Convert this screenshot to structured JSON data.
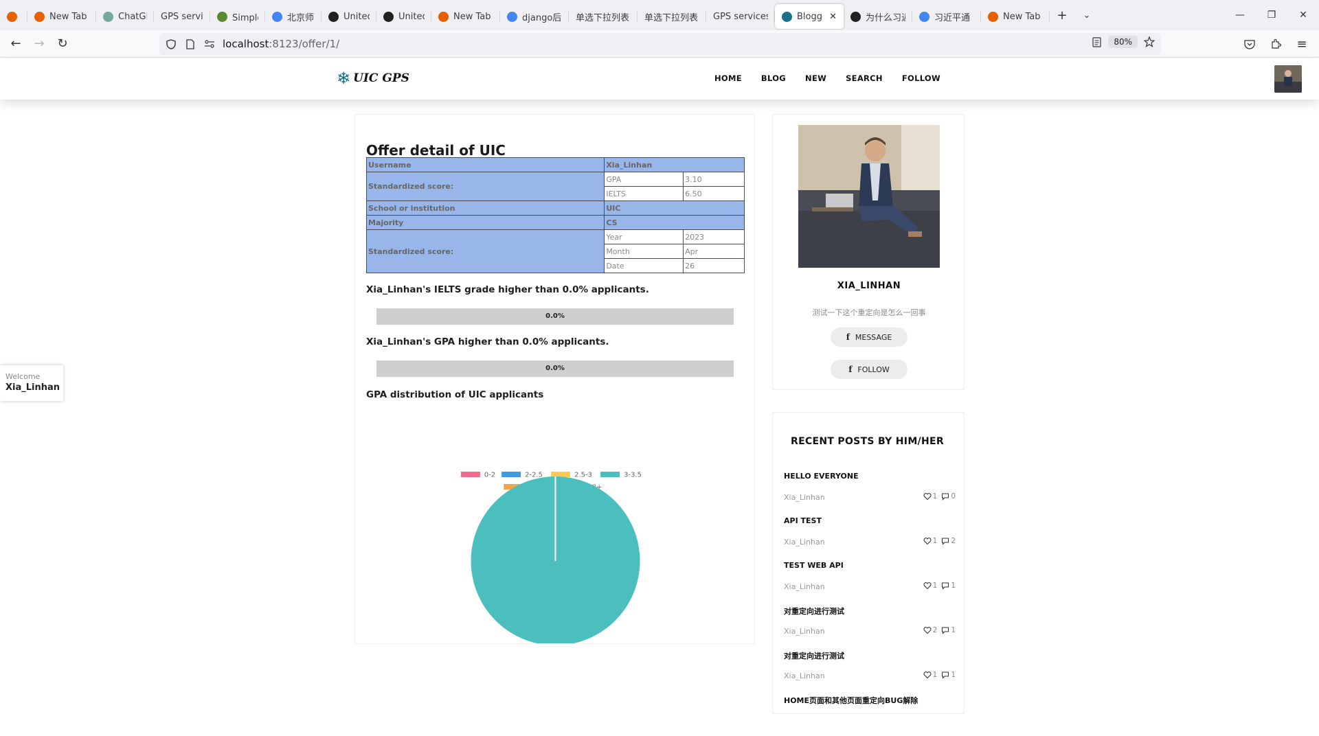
{
  "browser": {
    "tabs": [
      {
        "title": "",
        "favicon_color": "#e66000",
        "pinned": true
      },
      {
        "title": "New Tab",
        "favicon_color": "#e66000"
      },
      {
        "title": "ChatGPT",
        "favicon_color": "#74aa9c"
      },
      {
        "title": "GPS services",
        "favicon_color": ""
      },
      {
        "title": "Simple社",
        "favicon_color": "#5a8a2f"
      },
      {
        "title": "北京师范大",
        "favicon_color": "#4285f4"
      },
      {
        "title": "United In",
        "favicon_color": "#222222"
      },
      {
        "title": "United In",
        "favicon_color": "#222222"
      },
      {
        "title": "New Tab",
        "favicon_color": "#e66000"
      },
      {
        "title": "django后",
        "favicon_color": "#4285f4"
      },
      {
        "title": "单选下拉列表",
        "favicon_color": ""
      },
      {
        "title": "单选下拉列表",
        "favicon_color": ""
      },
      {
        "title": "GPS services",
        "favicon_color": ""
      },
      {
        "title": "Blogger",
        "favicon_color": "#1a6f8a",
        "active": true
      },
      {
        "title": "为什么习近",
        "favicon_color": "#222222"
      },
      {
        "title": "习近平通",
        "favicon_color": "#4285f4"
      },
      {
        "title": "New Tab",
        "favicon_color": "#e66000"
      }
    ],
    "url_host": "localhost",
    "url_rest": ":8123/offer/1/",
    "zoom": "80%"
  },
  "site": {
    "logo_text": "UIC GPS",
    "menu": [
      "HOME",
      "BLOG",
      "NEW",
      "SEARCH",
      "FOLLOW"
    ]
  },
  "welcome": {
    "label": "Welcome",
    "user": "Xia_Linhan"
  },
  "offer": {
    "title": "Offer detail of UIC",
    "rows": {
      "username_label": "Username",
      "username_value": "Xia_Linhan",
      "score_label": "Standardized score:",
      "gpa_label": "GPA",
      "gpa_value": "3.10",
      "ielts_label": "IELTS",
      "ielts_value": "6.50",
      "school_label": "School or institution",
      "school_value": "UIC",
      "major_label": "Majority",
      "major_value": "CS",
      "date_group_label": "Standardized score:",
      "year_label": "Year",
      "year_value": "2023",
      "month_label": "Month",
      "month_value": "Apr",
      "date_label": "Date",
      "date_value": "26"
    },
    "ielts_statement": "Xia_Linhan's IELTS grade higher than 0.0% applicants.",
    "ielts_percent": 0.0,
    "ielts_percent_label": "0.0%",
    "gpa_statement": "Xia_Linhan's GPA higher than 0.0% applicants.",
    "gpa_percent": 0.0,
    "gpa_percent_label": "0.0%",
    "chart_heading": "GPA distribution of UIC applicants"
  },
  "chart_data": {
    "type": "pie",
    "title": "",
    "categories": [
      "0-2",
      "2-2.5",
      "2.5-3",
      "3-3.5",
      "3.5-3.8",
      "3.8+"
    ],
    "values": [
      0,
      0,
      0,
      1,
      0,
      0
    ],
    "colors": [
      "#f06b8b",
      "#3d9be0",
      "#f9c956",
      "#4bbfbd",
      "#f5a447",
      "#9b6bf0"
    ],
    "legend": "top"
  },
  "profile": {
    "name": "XIA_LINHAN",
    "bio": "测试一下这个重定向是怎么一回事",
    "message_label": "MESSAGE",
    "follow_label": "FOLLOW"
  },
  "posts": {
    "heading": "RECENT POSTS BY HIM/HER",
    "items": [
      {
        "title": "HELLO EVERYONE",
        "author": "Xia_Linhan",
        "likes": "1",
        "comments": "0"
      },
      {
        "title": "API TEST",
        "author": "Xia_Linhan",
        "likes": "1",
        "comments": "2"
      },
      {
        "title": "TEST WEB API",
        "author": "Xia_Linhan",
        "likes": "1",
        "comments": "1"
      },
      {
        "title": "对重定向进行测试",
        "author": "Xia_Linhan",
        "likes": "2",
        "comments": "1"
      },
      {
        "title": "对重定向进行测试",
        "author": "Xia_Linhan",
        "likes": "1",
        "comments": "1"
      },
      {
        "title": "HOME页面和其他页面重定向BUG解除",
        "author": "",
        "likes": "",
        "comments": ""
      }
    ]
  }
}
